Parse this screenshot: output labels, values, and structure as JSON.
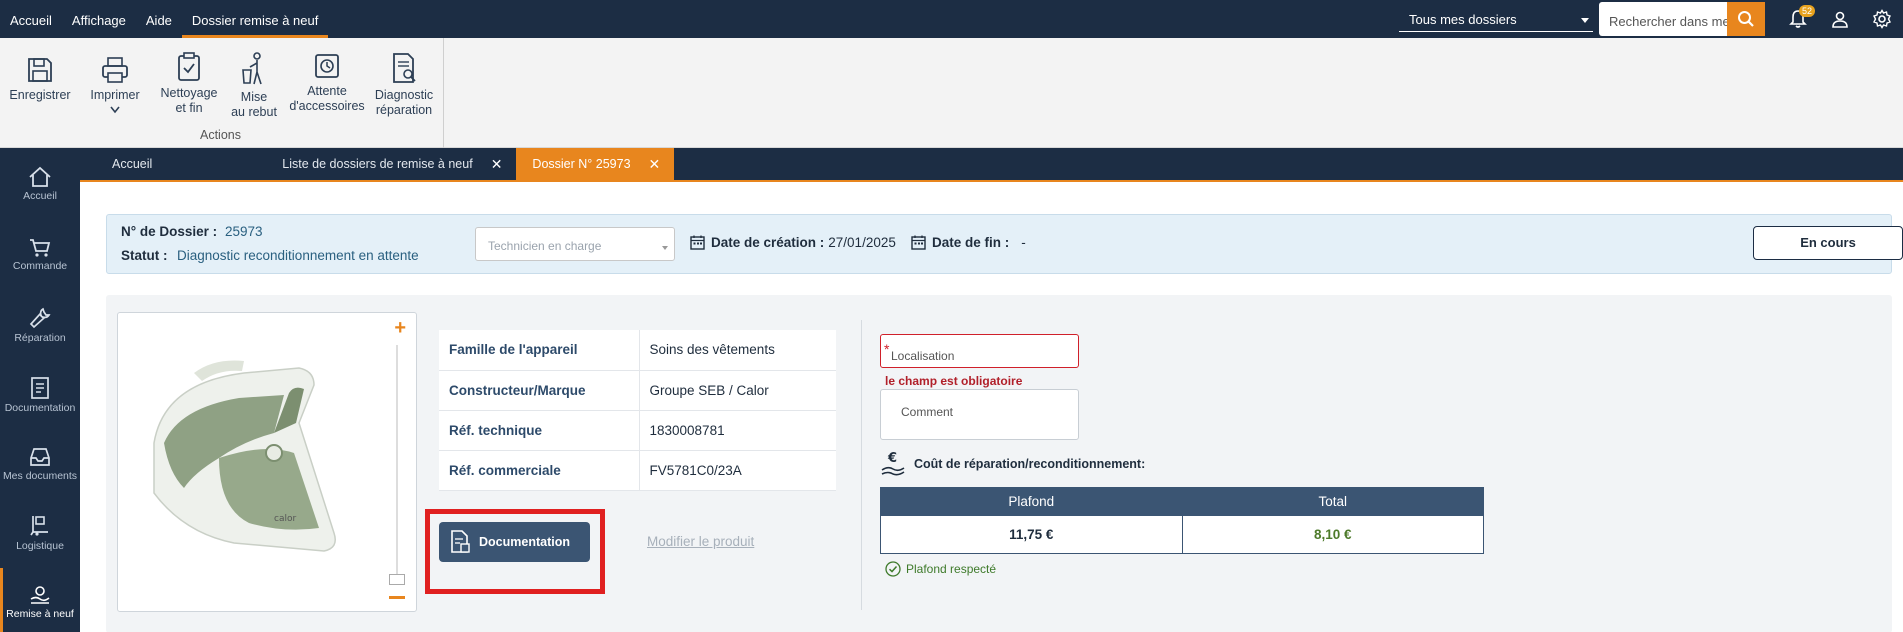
{
  "menu": {
    "items": [
      {
        "label": "Accueil",
        "active": false
      },
      {
        "label": "Affichage",
        "active": false
      },
      {
        "label": "Aide",
        "active": false
      },
      {
        "label": "Dossier remise à neuf",
        "active": true
      }
    ]
  },
  "topbar": {
    "scope_selected": "Tous mes dossiers",
    "search_placeholder": "Rechercher dans mes dossiers",
    "notification_count": "52"
  },
  "ribbon": {
    "buttons": {
      "save": "Enregistrer",
      "print": "Imprimer",
      "cleaning_l1": "Nettoyage",
      "cleaning_l2": "et fin",
      "scrap_l1": "Mise",
      "scrap_l2": "au rebut",
      "accessories_l1": "Attente",
      "accessories_l2": "d'accessoires",
      "diagnostic_l1": "Diagnostic",
      "diagnostic_l2": "réparation"
    },
    "group_label": "Actions"
  },
  "sidebar": {
    "items": [
      {
        "label": "Accueil",
        "icon": "home-icon"
      },
      {
        "label": "Commande",
        "icon": "cart-icon"
      },
      {
        "label": "Réparation",
        "icon": "wrench-icon"
      },
      {
        "label": "Documentation",
        "icon": "document-icon"
      },
      {
        "label": "Mes documents",
        "icon": "inbox-icon"
      },
      {
        "label": "Logistique",
        "icon": "logistics-icon"
      },
      {
        "label": "Remise à neuf",
        "icon": "refurbish-icon",
        "active": true
      }
    ]
  },
  "tabs": [
    {
      "label": "Accueil",
      "closable": false,
      "active": false
    },
    {
      "label": "Liste de dossiers de remise à neuf",
      "closable": true,
      "active": false
    },
    {
      "label": "Dossier N° 25973",
      "closable": true,
      "active": true
    }
  ],
  "dossier": {
    "number_label": "N° de Dossier :",
    "number_value": "25973",
    "status_label": "Statut :",
    "status_value": "Diagnostic reconditionnement en attente",
    "technician_placeholder": "Technicien en charge",
    "creation_label": "Date de création :",
    "creation_value": "27/01/2025",
    "end_label": "Date de fin :",
    "end_value": "-",
    "state_button": "En cours"
  },
  "product": {
    "properties": [
      {
        "key": "Famille de l'appareil",
        "value": "Soins des vêtements"
      },
      {
        "key": "Constructeur/Marque",
        "value": "Groupe SEB / Calor"
      },
      {
        "key": "Réf. technique",
        "value": "1830008781"
      },
      {
        "key": "Réf. commerciale",
        "value": "FV5781C0/23A"
      }
    ],
    "documentation_button": "Documentation",
    "modify_link": "Modifier le produit"
  },
  "form": {
    "location_placeholder": "Localisation",
    "location_error": "le champ est obligatoire",
    "comment_placeholder": "Comment"
  },
  "cost": {
    "title": "Coût de réparation/reconditionnement:",
    "headers": [
      "Plafond",
      "Total"
    ],
    "plafond": "11,75 €",
    "total": "8,10 €",
    "status": "Plafond respecté"
  },
  "colors": {
    "navy": "#1c2d44",
    "accent": "#e8861e",
    "table_header": "#3b5573",
    "error": "#d0202a",
    "success": "#3e7a2a"
  }
}
